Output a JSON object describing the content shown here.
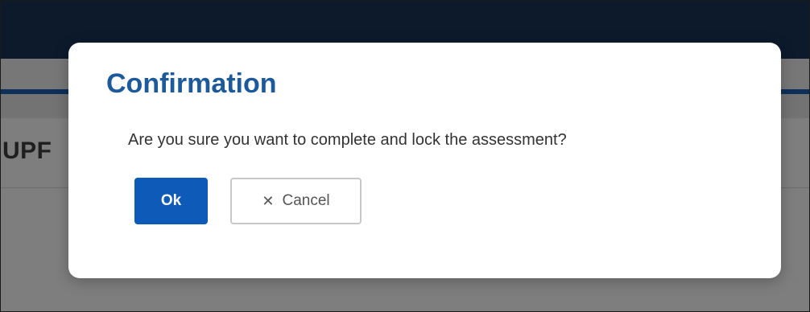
{
  "background": {
    "heading_fragment": "UPF"
  },
  "dialog": {
    "title": "Confirmation",
    "message": "Are you sure you want to complete and lock the assessment?",
    "ok_label": "Ok",
    "cancel_label": "Cancel",
    "cancel_icon": "close-icon"
  },
  "colors": {
    "title": "#1c5a9c",
    "primary_button": "#0d5ab8",
    "top_bar": "#0c1a2c",
    "accent_line": "#0d2f59"
  }
}
